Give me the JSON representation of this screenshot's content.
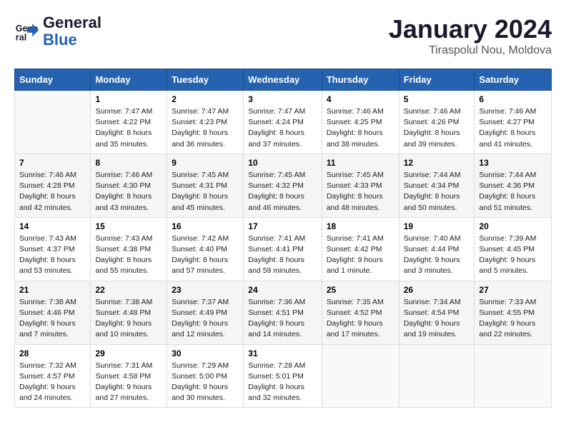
{
  "header": {
    "logo_line1": "General",
    "logo_line2": "Blue",
    "month": "January 2024",
    "location": "Tiraspolul Nou, Moldova"
  },
  "weekdays": [
    "Sunday",
    "Monday",
    "Tuesday",
    "Wednesday",
    "Thursday",
    "Friday",
    "Saturday"
  ],
  "weeks": [
    [
      {
        "day": "",
        "empty": true
      },
      {
        "day": "1",
        "sunrise": "7:47 AM",
        "sunset": "4:22 PM",
        "daylight": "8 hours and 35 minutes."
      },
      {
        "day": "2",
        "sunrise": "7:47 AM",
        "sunset": "4:23 PM",
        "daylight": "8 hours and 36 minutes."
      },
      {
        "day": "3",
        "sunrise": "7:47 AM",
        "sunset": "4:24 PM",
        "daylight": "8 hours and 37 minutes."
      },
      {
        "day": "4",
        "sunrise": "7:46 AM",
        "sunset": "4:25 PM",
        "daylight": "8 hours and 38 minutes."
      },
      {
        "day": "5",
        "sunrise": "7:46 AM",
        "sunset": "4:26 PM",
        "daylight": "8 hours and 39 minutes."
      },
      {
        "day": "6",
        "sunrise": "7:46 AM",
        "sunset": "4:27 PM",
        "daylight": "8 hours and 41 minutes."
      }
    ],
    [
      {
        "day": "7",
        "sunrise": "7:46 AM",
        "sunset": "4:28 PM",
        "daylight": "8 hours and 42 minutes."
      },
      {
        "day": "8",
        "sunrise": "7:46 AM",
        "sunset": "4:30 PM",
        "daylight": "8 hours and 43 minutes."
      },
      {
        "day": "9",
        "sunrise": "7:45 AM",
        "sunset": "4:31 PM",
        "daylight": "8 hours and 45 minutes."
      },
      {
        "day": "10",
        "sunrise": "7:45 AM",
        "sunset": "4:32 PM",
        "daylight": "8 hours and 46 minutes."
      },
      {
        "day": "11",
        "sunrise": "7:45 AM",
        "sunset": "4:33 PM",
        "daylight": "8 hours and 48 minutes."
      },
      {
        "day": "12",
        "sunrise": "7:44 AM",
        "sunset": "4:34 PM",
        "daylight": "8 hours and 50 minutes."
      },
      {
        "day": "13",
        "sunrise": "7:44 AM",
        "sunset": "4:36 PM",
        "daylight": "8 hours and 51 minutes."
      }
    ],
    [
      {
        "day": "14",
        "sunrise": "7:43 AM",
        "sunset": "4:37 PM",
        "daylight": "8 hours and 53 minutes."
      },
      {
        "day": "15",
        "sunrise": "7:43 AM",
        "sunset": "4:38 PM",
        "daylight": "8 hours and 55 minutes."
      },
      {
        "day": "16",
        "sunrise": "7:42 AM",
        "sunset": "4:40 PM",
        "daylight": "8 hours and 57 minutes."
      },
      {
        "day": "17",
        "sunrise": "7:41 AM",
        "sunset": "4:41 PM",
        "daylight": "8 hours and 59 minutes."
      },
      {
        "day": "18",
        "sunrise": "7:41 AM",
        "sunset": "4:42 PM",
        "daylight": "9 hours and 1 minute."
      },
      {
        "day": "19",
        "sunrise": "7:40 AM",
        "sunset": "4:44 PM",
        "daylight": "9 hours and 3 minutes."
      },
      {
        "day": "20",
        "sunrise": "7:39 AM",
        "sunset": "4:45 PM",
        "daylight": "9 hours and 5 minutes."
      }
    ],
    [
      {
        "day": "21",
        "sunrise": "7:38 AM",
        "sunset": "4:46 PM",
        "daylight": "9 hours and 7 minutes."
      },
      {
        "day": "22",
        "sunrise": "7:38 AM",
        "sunset": "4:48 PM",
        "daylight": "9 hours and 10 minutes."
      },
      {
        "day": "23",
        "sunrise": "7:37 AM",
        "sunset": "4:49 PM",
        "daylight": "9 hours and 12 minutes."
      },
      {
        "day": "24",
        "sunrise": "7:36 AM",
        "sunset": "4:51 PM",
        "daylight": "9 hours and 14 minutes."
      },
      {
        "day": "25",
        "sunrise": "7:35 AM",
        "sunset": "4:52 PM",
        "daylight": "9 hours and 17 minutes."
      },
      {
        "day": "26",
        "sunrise": "7:34 AM",
        "sunset": "4:54 PM",
        "daylight": "9 hours and 19 minutes."
      },
      {
        "day": "27",
        "sunrise": "7:33 AM",
        "sunset": "4:55 PM",
        "daylight": "9 hours and 22 minutes."
      }
    ],
    [
      {
        "day": "28",
        "sunrise": "7:32 AM",
        "sunset": "4:57 PM",
        "daylight": "9 hours and 24 minutes."
      },
      {
        "day": "29",
        "sunrise": "7:31 AM",
        "sunset": "4:58 PM",
        "daylight": "9 hours and 27 minutes."
      },
      {
        "day": "30",
        "sunrise": "7:29 AM",
        "sunset": "5:00 PM",
        "daylight": "9 hours and 30 minutes."
      },
      {
        "day": "31",
        "sunrise": "7:28 AM",
        "sunset": "5:01 PM",
        "daylight": "9 hours and 32 minutes."
      },
      {
        "day": "",
        "empty": true
      },
      {
        "day": "",
        "empty": true
      },
      {
        "day": "",
        "empty": true
      }
    ]
  ]
}
